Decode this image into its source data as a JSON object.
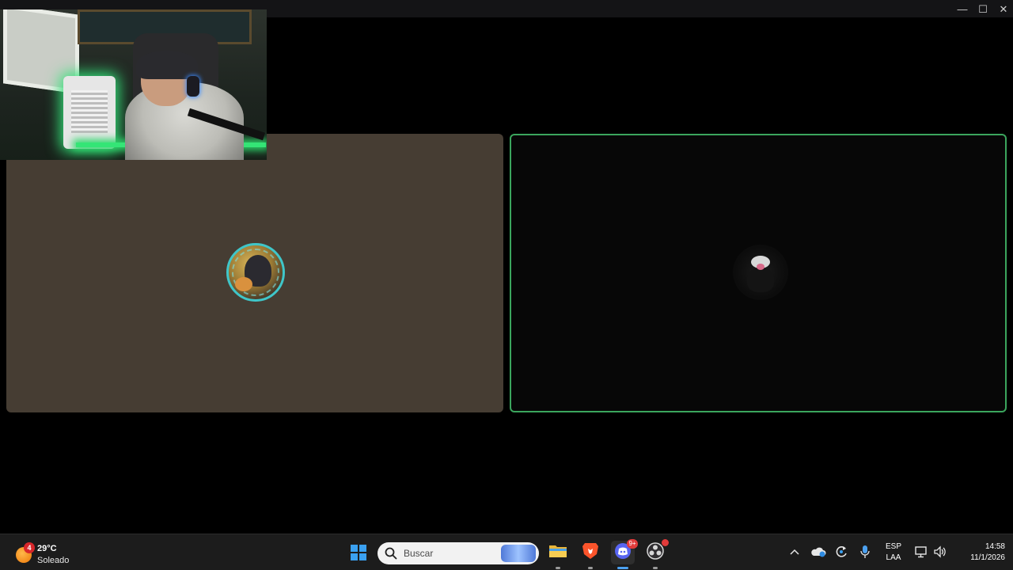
{
  "window": {
    "controls": {
      "minimize": "—",
      "maximize": "☐",
      "close": "✕"
    }
  },
  "call": {
    "participants": [
      {
        "tile": "left",
        "speaking": false,
        "tile_color": "#463d33",
        "avatar_ring_color": "#3fc6c9"
      },
      {
        "tile": "right",
        "speaking": true,
        "tile_color": "#070707",
        "speaking_border_color": "#3ba55d"
      }
    ]
  },
  "taskbar": {
    "weather": {
      "badge": "4",
      "temperature": "29°C",
      "condition": "Soleado",
      "icon": "sun-icon"
    },
    "search": {
      "placeholder": "Buscar",
      "icon": "search-icon"
    },
    "apps": [
      {
        "name": "start",
        "icon": "windows-icon"
      },
      {
        "name": "file-explorer",
        "icon": "folder-icon",
        "running": true
      },
      {
        "name": "brave",
        "icon": "brave-icon",
        "running": true
      },
      {
        "name": "discord",
        "icon": "discord-icon",
        "badge": "9+",
        "running": true,
        "active": true
      },
      {
        "name": "obs",
        "icon": "obs-icon",
        "running": true,
        "notification": true
      }
    ],
    "tray": {
      "chevron_icon": "chevron-up-icon",
      "cloud_icon": "onedrive-icon",
      "refresh_icon": "sync-icon",
      "mic_icon": "microphone-icon",
      "language_line1": "ESP",
      "language_line2": "LAA",
      "network_icon": "network-icon",
      "volume_icon": "volume-icon",
      "time": "14:58",
      "date": "11/1/2026"
    }
  },
  "colors": {
    "taskbar_bg": "#1c1c1c",
    "accent_blue": "#4ca1f0",
    "speaking_green": "#3ba55d",
    "badge_red": "#e23b3b"
  }
}
